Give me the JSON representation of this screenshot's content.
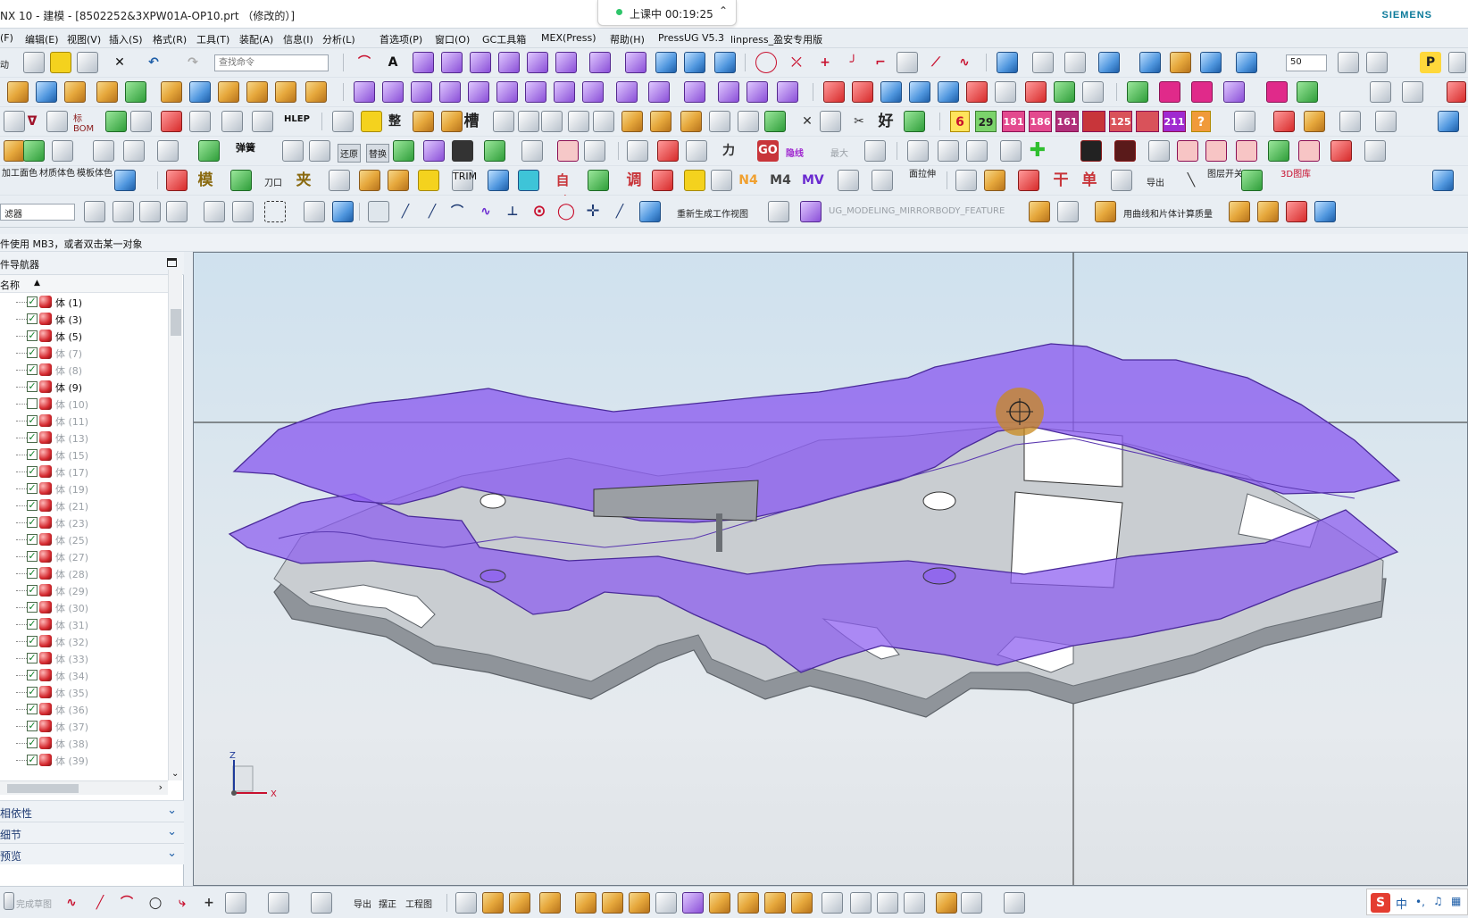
{
  "titlebar": {
    "title": "NX 10 - 建模 - [8502252&3XPW01A-OP10.prt  （修改的）]",
    "brand": "SIEMENS",
    "live_status": "上课中 00:19:25"
  },
  "menu": [
    "(F)",
    "编辑(E)",
    "视图(V)",
    "插入(S)",
    "格式(R)",
    "工具(T)",
    "装配(A)",
    "信息(I)",
    "分析(L)",
    "首选项(P)",
    "窗口(O)",
    "GC工具箱",
    "MEX(Press)",
    "帮助(H)",
    "PressUG V5.3",
    "linpress_盈安专用版"
  ],
  "toolbar1": {
    "left_label": "动",
    "search_placeholder": "查找命令",
    "zoom_value": "50"
  },
  "toolbar3": {
    "labels": [
      "标 BOM",
      "HLEP",
      "整",
      "槽",
      "好"
    ],
    "numbers": [
      "6",
      "29",
      "181",
      "186",
      "161",
      "125",
      "211"
    ]
  },
  "toolbar4": {
    "labels": [
      "弹簧",
      "还原",
      "替换",
      "力",
      "GO",
      "隐线",
      "最大"
    ]
  },
  "toolbar5": {
    "labels": [
      "加工面色",
      "材质体色",
      "模板体色",
      "模",
      "刀口",
      "夹",
      "TRIM",
      "自动",
      "调",
      "N4",
      "M4",
      "MV",
      "面拉伸",
      "干",
      "单",
      "导出",
      "图层开关",
      "3D图库"
    ]
  },
  "toolbar6": {
    "filter_value": "滤器",
    "rebuild_view_label": "重新生成工作视图",
    "feature_label": "UG_MODELING_MIRRORBODY_FEATURE",
    "mass_label": "用曲线和片体计算质量"
  },
  "hint": "件使用 MB3，或者双击某一对象",
  "navigator": {
    "title": "件导航器",
    "column": "名称",
    "rows": [
      {
        "label": "体 (1)",
        "checked": true,
        "dim": false
      },
      {
        "label": "体 (3)",
        "checked": true,
        "dim": false
      },
      {
        "label": "体 (5)",
        "checked": true,
        "dim": false
      },
      {
        "label": "体 (7)",
        "checked": true,
        "dim": true
      },
      {
        "label": "体 (8)",
        "checked": true,
        "dim": true
      },
      {
        "label": "体 (9)",
        "checked": true,
        "dim": false
      },
      {
        "label": "体 (10)",
        "checked": false,
        "dim": true
      },
      {
        "label": "体 (11)",
        "checked": true,
        "dim": true
      },
      {
        "label": "体 (13)",
        "checked": true,
        "dim": true
      },
      {
        "label": "体 (15)",
        "checked": true,
        "dim": true
      },
      {
        "label": "体 (17)",
        "checked": true,
        "dim": true
      },
      {
        "label": "体 (19)",
        "checked": true,
        "dim": true
      },
      {
        "label": "体 (21)",
        "checked": true,
        "dim": true
      },
      {
        "label": "体 (23)",
        "checked": true,
        "dim": true
      },
      {
        "label": "体 (25)",
        "checked": true,
        "dim": true
      },
      {
        "label": "体 (27)",
        "checked": true,
        "dim": true
      },
      {
        "label": "体 (28)",
        "checked": true,
        "dim": true
      },
      {
        "label": "体 (29)",
        "checked": true,
        "dim": true
      },
      {
        "label": "体 (30)",
        "checked": true,
        "dim": true
      },
      {
        "label": "体 (31)",
        "checked": true,
        "dim": true
      },
      {
        "label": "体 (32)",
        "checked": true,
        "dim": true
      },
      {
        "label": "体 (33)",
        "checked": true,
        "dim": true
      },
      {
        "label": "体 (34)",
        "checked": true,
        "dim": true
      },
      {
        "label": "体 (35)",
        "checked": true,
        "dim": true
      },
      {
        "label": "体 (36)",
        "checked": true,
        "dim": true
      },
      {
        "label": "体 (37)",
        "checked": true,
        "dim": true
      },
      {
        "label": "体 (38)",
        "checked": true,
        "dim": true
      },
      {
        "label": "体 (39)",
        "checked": true,
        "dim": true
      }
    ],
    "panels": [
      "相依性",
      "细节",
      "预览"
    ]
  },
  "viewport": {
    "triad_z": "Z",
    "triad_x": "X"
  },
  "bottombar": {
    "labels": [
      "完成草图",
      "导出",
      "摆正",
      "工程图"
    ],
    "ime": "中"
  },
  "colors": {
    "purple_sheet": "#8a5cf0",
    "grey_part": "#9a9fa5",
    "accent_blue": "#1f5fa8"
  }
}
